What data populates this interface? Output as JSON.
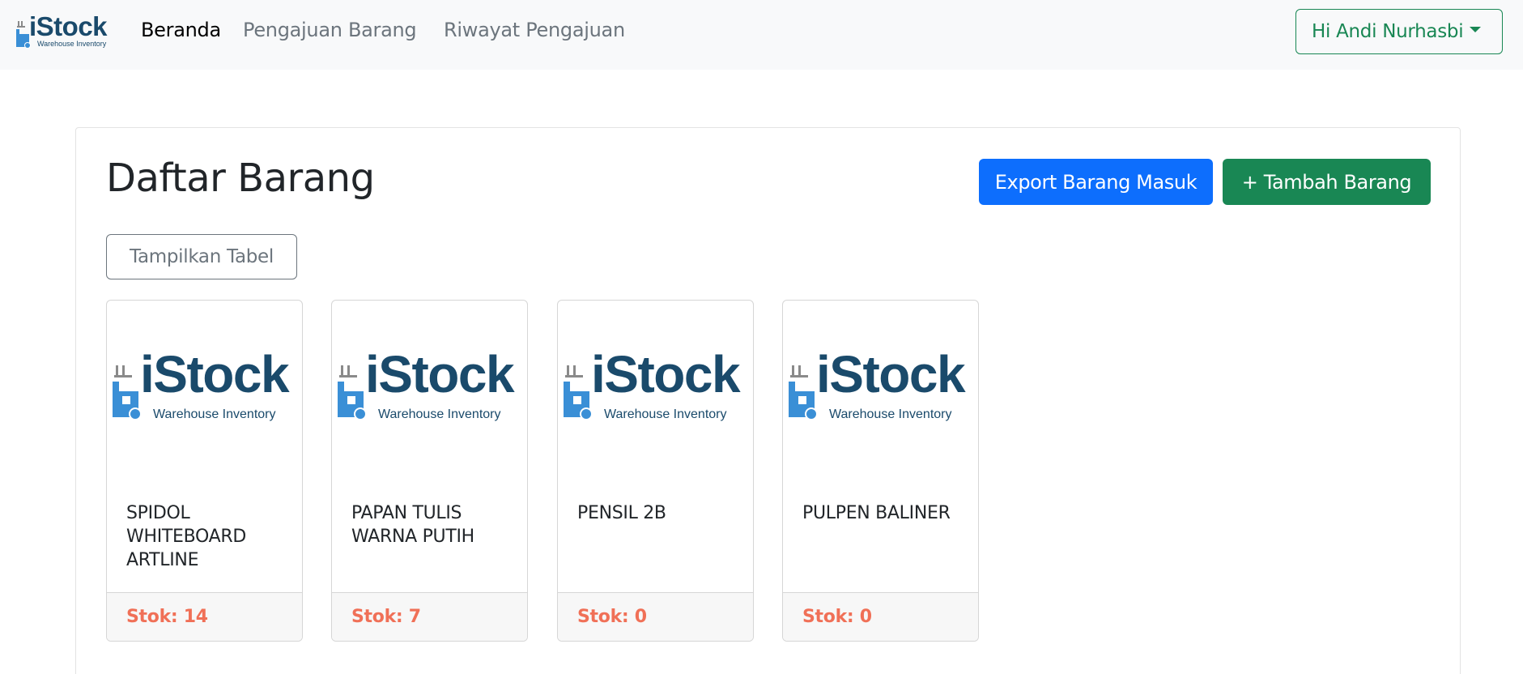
{
  "navbar": {
    "brand": {
      "name": "iStock",
      "subtitle": "Warehouse Inventory"
    },
    "links": [
      "Beranda",
      "Pengajuan Barang",
      "Riwayat Pengajuan"
    ],
    "active_index": 0,
    "user_label": "Hi Andi Nurhasbi"
  },
  "main": {
    "title": "Daftar Barang",
    "export_label": "Export Barang Masuk",
    "add_label": "+ Tambah Barang",
    "table_toggle_label": "Tampilkan Tabel"
  },
  "items": [
    {
      "name": "SPIDOL WHITEBOARD ARTLINE",
      "stock": "Stok: 14"
    },
    {
      "name": "PAPAN TULIS WARNA PUTIH",
      "stock": "Stok: 7"
    },
    {
      "name": "PENSIL 2B",
      "stock": "Stok: 0"
    },
    {
      "name": "PULPEN BALINER",
      "stock": "Stok: 0"
    }
  ],
  "colors": {
    "brand": "#1a4a6b",
    "brand_icon": "#3a8fd6",
    "primary": "#0d6efd",
    "success": "#198754",
    "stock": "#f07057"
  },
  "icons": {
    "brand": "forklift-icon",
    "user_menu": "caret-down-icon"
  }
}
